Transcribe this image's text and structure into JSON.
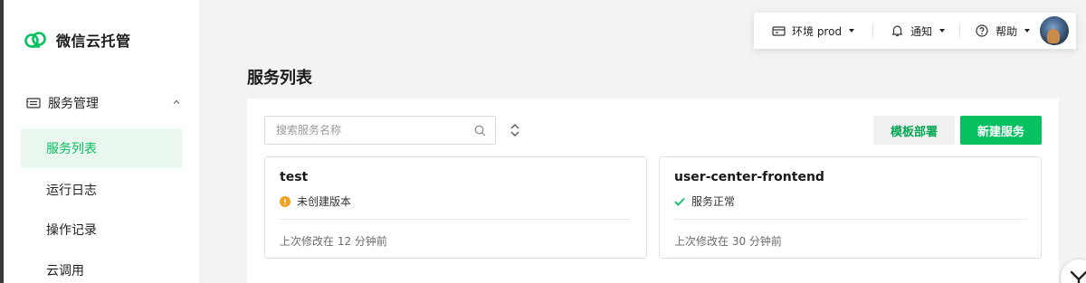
{
  "brand": {
    "name": "微信云托管"
  },
  "sidebar": {
    "group": {
      "label": "服务管理",
      "icon": "service-management-icon",
      "expanded": true
    },
    "items": [
      {
        "label": "服务列表",
        "active": true
      },
      {
        "label": "运行日志",
        "active": false
      },
      {
        "label": "操作记录",
        "active": false
      },
      {
        "label": "云调用",
        "active": false
      }
    ]
  },
  "topbar": {
    "env": {
      "label": "环境 prod",
      "icon": "environment-icon"
    },
    "notify": {
      "label": "通知",
      "icon": "bell-icon"
    },
    "help": {
      "label": "帮助",
      "icon": "question-icon"
    },
    "avatar": {
      "icon": "user-avatar"
    }
  },
  "main": {
    "title": "服务列表",
    "search": {
      "placeholder": "搜索服务名称",
      "value": ""
    },
    "buttons": {
      "template": "模板部署",
      "new_service": "新建服务"
    },
    "services": [
      {
        "name": "test",
        "status": "未创建版本",
        "status_type": "warning",
        "updated": "上次修改在 12 分钟前"
      },
      {
        "name": "user-center-frontend",
        "status": "服务正常",
        "status_type": "success",
        "updated": "上次修改在 30 分钟前"
      }
    ]
  },
  "colors": {
    "accent": "#07c160",
    "accent_bg": "#e9f7ee",
    "warning": "#f0a020",
    "background": "#f3f3f3"
  }
}
